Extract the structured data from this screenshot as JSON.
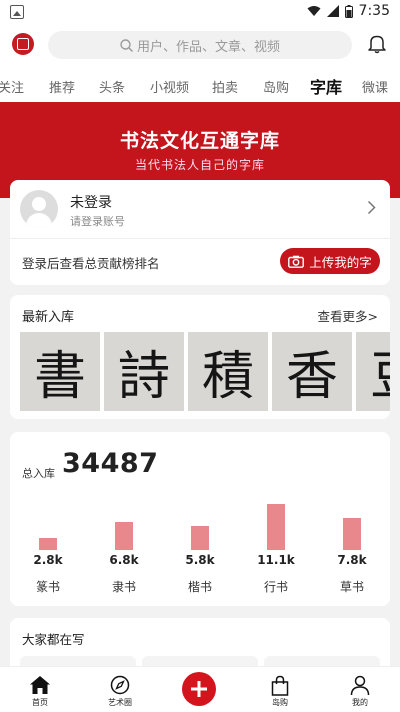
{
  "statusbar": {
    "time": "7:35"
  },
  "search": {
    "placeholder": "用户、作品、文章、视频"
  },
  "tabs": [
    "关注",
    "推荐",
    "头条",
    "小视频",
    "拍卖",
    "岛购",
    "字库",
    "微课"
  ],
  "active_tab": "字库",
  "banner": {
    "title": "书法文化互通字库",
    "subtitle": "当代书法人自己的字库"
  },
  "login": {
    "name": "未登录",
    "hint": "请登录账号",
    "rank_text": "登录后查看总贡献榜排名",
    "upload_label": "上传我的字"
  },
  "newest": {
    "title": "最新入库",
    "more": "查看更多>",
    "glyphs": [
      "書",
      "詩",
      "積",
      "香",
      "豆"
    ]
  },
  "stats": {
    "total_label": "总入库",
    "total_value": "34487",
    "chart_data": {
      "type": "bar",
      "categories": [
        "篆书",
        "隶书",
        "楷书",
        "行书",
        "草书"
      ],
      "values": [
        2.8,
        6.8,
        5.8,
        11.1,
        7.8
      ],
      "value_labels": [
        "2.8k",
        "6.8k",
        "5.8k",
        "11.1k",
        "7.8k"
      ],
      "unit": "k",
      "color": "#e8878c"
    }
  },
  "writing": {
    "title": "大家都在写"
  },
  "nav": {
    "home": "首页",
    "circle": "艺术圈",
    "shop": "岛购",
    "me": "我的"
  },
  "colors": {
    "brand_red": "#c4141c"
  }
}
